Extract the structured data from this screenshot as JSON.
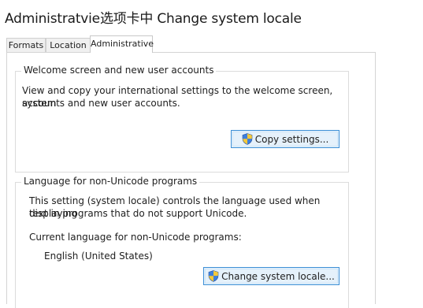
{
  "caption": "Administratvie选项卡中 Change system locale",
  "tabs": [
    {
      "label": "Formats"
    },
    {
      "label": "Location"
    },
    {
      "label": "Administrative"
    }
  ],
  "welcome": {
    "title": "Welcome screen and new user accounts",
    "description_line1": "View and copy your international settings to the welcome screen, system",
    "description_line2": "accounts and new user accounts.",
    "button_label": "Copy settings..."
  },
  "non_unicode": {
    "title": "Language for non-Unicode programs",
    "description_line1": "This setting (system locale) controls the language used when displaying",
    "description_line2": "text in programs that do not support Unicode.",
    "current_label": "Current language for non-Unicode programs:",
    "current_value": "English (United States)",
    "button_label": "Change system locale..."
  },
  "icons": {
    "shield": "uac-shield-icon"
  }
}
